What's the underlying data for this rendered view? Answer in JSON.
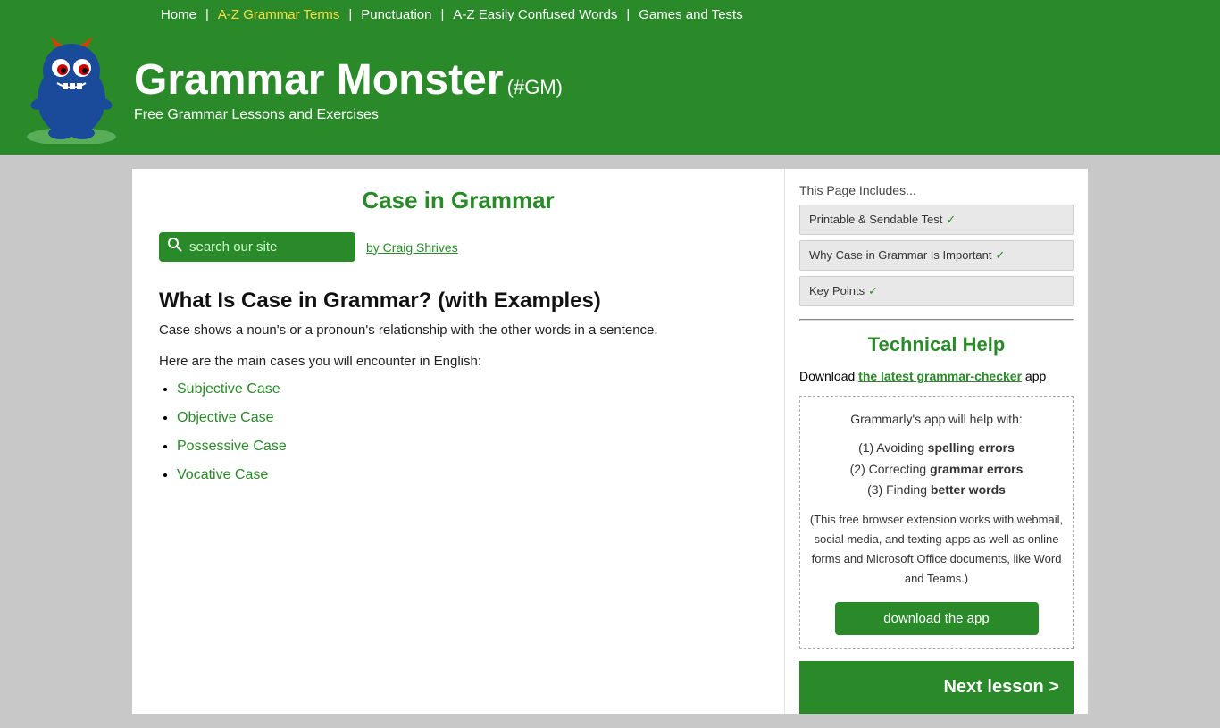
{
  "header": {
    "nav": {
      "home": "Home",
      "az_grammar": "A-Z Grammar Terms",
      "punctuation": "Punctuation",
      "confused": "A-Z Easily Confused Words",
      "games": "Games and Tests"
    },
    "site_title": "Grammar Monster",
    "site_hashtag": "(#GM)",
    "site_tagline": "Free Grammar Lessons and Exercises"
  },
  "main": {
    "page_title": "Case in Grammar",
    "search_placeholder": "search our site",
    "author_label": "by Craig Shrives",
    "article_heading": "What Is Case in Grammar? (with Examples)",
    "article_intro": "Case shows a noun's or a pronoun's relationship with the other words in a sentence.",
    "article_subtext": "Here are the main cases you will encounter in English:",
    "cases": [
      {
        "label": "Subjective Case",
        "href": "#"
      },
      {
        "label": "Objective Case",
        "href": "#"
      },
      {
        "label": "Possessive Case",
        "href": "#"
      },
      {
        "label": "Vocative Case",
        "href": "#"
      }
    ]
  },
  "this_page": {
    "label": "This Page Includes...",
    "buttons": [
      {
        "text": "Printable & Sendable Test",
        "has_check": true
      },
      {
        "text": "Why Case in Grammar Is Important",
        "has_check": true
      },
      {
        "text": "Key Points",
        "has_check": true
      }
    ]
  },
  "sidebar": {
    "tech_help_title": "Technical Help",
    "grammarly_text_before": "Download ",
    "grammarly_link_text": "the latest grammar-checker",
    "grammarly_text_after": " app",
    "grammarly_box_line1": "Grammarly's app will help with:",
    "grammarly_point1_before": "(1) Avoiding ",
    "grammarly_point1_bold": "spelling errors",
    "grammarly_point2_before": "(2) Correcting ",
    "grammarly_point2_bold": "grammar errors",
    "grammarly_point3_before": "(3) Finding ",
    "grammarly_point3_bold": "better words",
    "grammarly_note": "(This free browser extension works with webmail, social media, and texting apps as well as online forms and Microsoft Office documents, like Word and Teams.)",
    "download_btn": "download the app",
    "next_lesson": "Next lesson >"
  }
}
